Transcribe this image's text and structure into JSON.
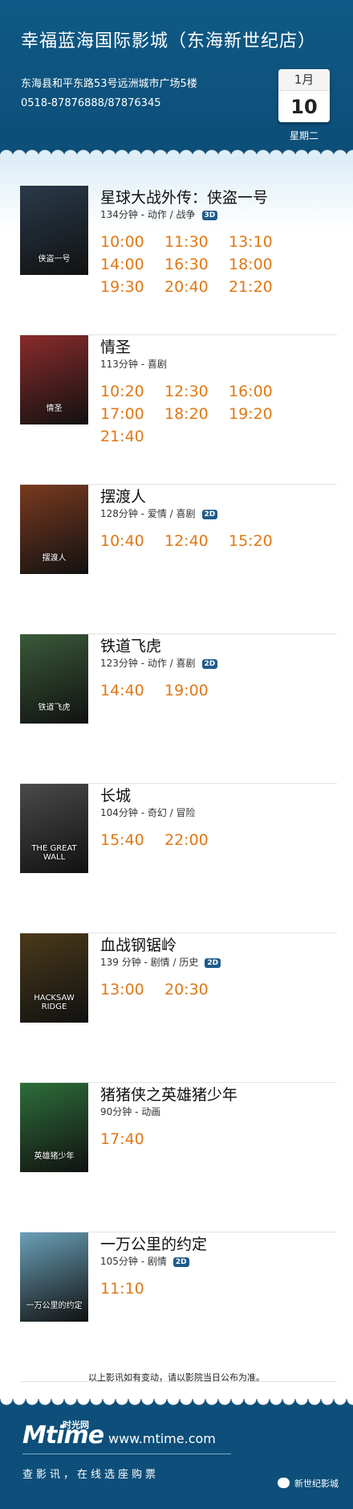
{
  "header": {
    "title": "幸福蓝海国际影城（东海新世纪店）",
    "address": "东海县和平东路53号远洲城市广场5楼",
    "phone": "0518-87876888/87876345",
    "calendar": {
      "month": "1月",
      "day": "10",
      "weekday": "星期二"
    }
  },
  "movies": [
    {
      "title": "星球大战外传：侠盗一号",
      "info": "134分钟 - 动作 / 战争",
      "format": "3D",
      "poster_text": "侠盗一号",
      "times": [
        "10:00",
        "11:30",
        "13:10",
        "14:00",
        "16:30",
        "18:00",
        "19:30",
        "20:40",
        "21:20"
      ]
    },
    {
      "title": "情圣",
      "info": "113分钟 - 喜剧",
      "format": "",
      "poster_text": "情圣",
      "times": [
        "10:20",
        "12:30",
        "16:00",
        "17:00",
        "18:20",
        "19:20",
        "21:40"
      ]
    },
    {
      "title": "摆渡人",
      "info": "128分钟 - 爱情 / 喜剧",
      "format": "2D",
      "poster_text": "摆渡人",
      "times": [
        "10:40",
        "12:40",
        "15:20"
      ]
    },
    {
      "title": "铁道飞虎",
      "info": "123分钟 - 动作 / 喜剧",
      "format": "2D",
      "poster_text": "铁道飞虎",
      "times": [
        "14:40",
        "19:00"
      ]
    },
    {
      "title": "长城",
      "info": "104分钟 - 奇幻 / 冒险",
      "format": "",
      "poster_text": "THE GREAT WALL",
      "times": [
        "15:40",
        "22:00"
      ]
    },
    {
      "title": "血战钢锯岭",
      "info": "139 分钟 - 剧情 / 历史",
      "format": "2D",
      "poster_text": "HACKSAW RIDGE",
      "times": [
        "13:00",
        "20:30"
      ]
    },
    {
      "title": "猪猪侠之英雄猪少年",
      "info": "90分钟 - 动画",
      "format": "",
      "poster_text": "英雄猪少年",
      "times": [
        "17:40"
      ]
    },
    {
      "title": "一万公里的约定",
      "info": "105分钟 - 剧情",
      "format": "2D",
      "poster_text": "一万公里的约定",
      "times": [
        "11:10"
      ]
    }
  ],
  "notice": "以上影讯如有变动，请以影院当日公布为准。",
  "footer": {
    "logo": "Mtime",
    "logo_cn": "时光网",
    "site": "www.mtime.com",
    "slogan": "查影讯，在线选座购票",
    "wechat_name": "新世纪影城"
  },
  "colors": {
    "header_bg": "#0f5a86",
    "time": "#e07815",
    "badge": "#1f5b8c"
  },
  "poster_colors": [
    "#2a3a4a",
    "#8a2b2b",
    "#7a3a20",
    "#3a5a3a",
    "#4a4a4a",
    "#4a3a1a",
    "#2e6e3a",
    "#6aa0b8"
  ]
}
